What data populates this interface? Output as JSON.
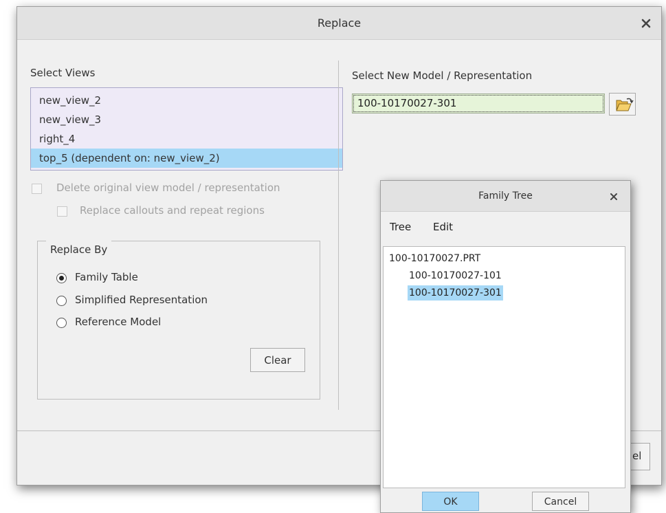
{
  "replace_dialog": {
    "title": "Replace",
    "select_views_label": "Select Views",
    "views": [
      {
        "label": "new_view_2",
        "selected": false
      },
      {
        "label": "new_view_3",
        "selected": false
      },
      {
        "label": "right_4",
        "selected": false
      },
      {
        "label": "top_5 (dependent on: new_view_2)",
        "selected": true
      }
    ],
    "delete_original_label": "Delete original view model / representation",
    "replace_callouts_label": "Replace callouts and repeat regions",
    "replace_by": {
      "legend": "Replace By",
      "options": [
        {
          "label": "Family Table",
          "selected": true
        },
        {
          "label": "Simplified Representation",
          "selected": false
        },
        {
          "label": "Reference Model",
          "selected": false
        }
      ],
      "clear_label": "Clear"
    },
    "select_new_model_label": "Select New Model / Representation",
    "new_model_value": "100-10170027-301",
    "cancel_fragment": "el"
  },
  "family_tree": {
    "title": "Family Tree",
    "menu": [
      "Tree",
      "Edit"
    ],
    "root": "100-10170027.PRT",
    "children": [
      {
        "label": "100-10170027-101",
        "selected": false
      },
      {
        "label": "100-10170027-301",
        "selected": true
      }
    ],
    "ok_label": "OK",
    "cancel_label": "Cancel"
  },
  "colors": {
    "selection": "#a6d8f6",
    "list_background": "#eeeaf7",
    "input_background": "#e6f4d9",
    "dialog_background": "#f0f0f0",
    "title_bar": "#e2e2e2"
  }
}
